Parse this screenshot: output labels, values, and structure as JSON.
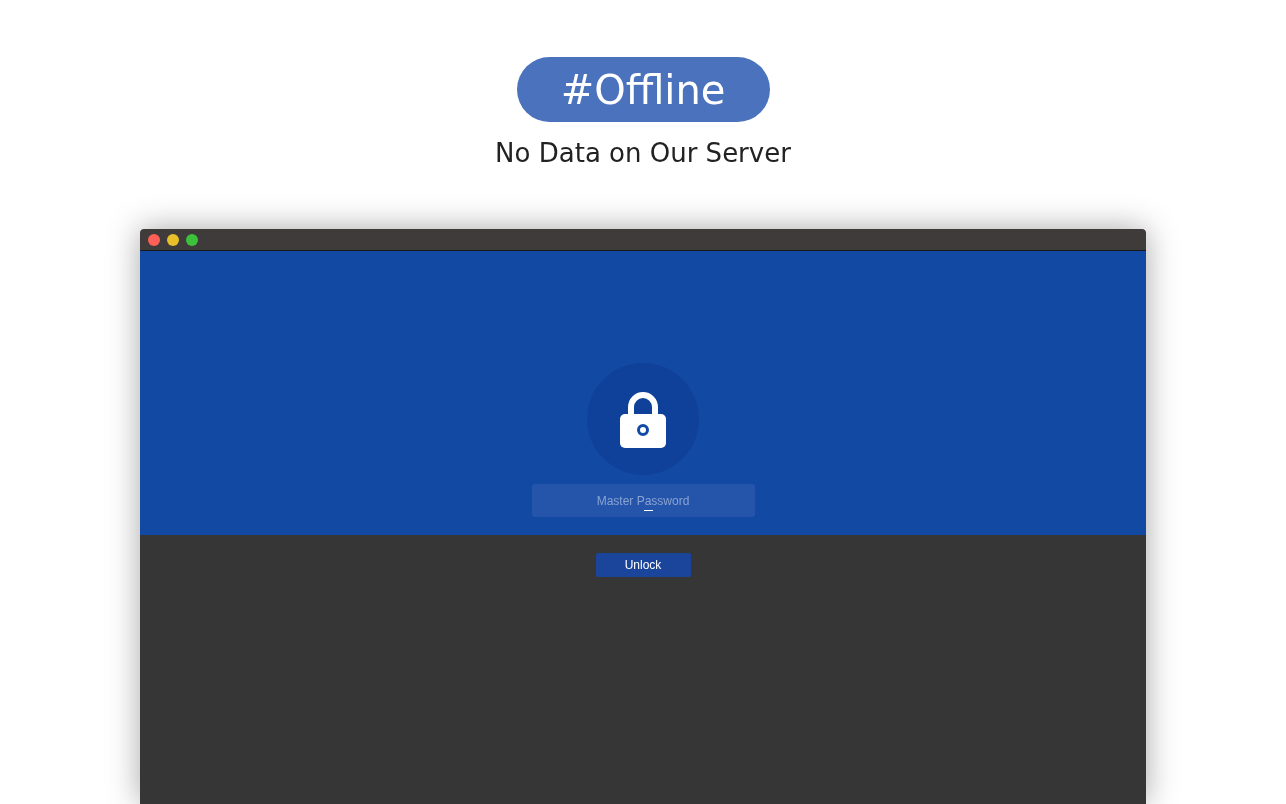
{
  "badge": "#Offline",
  "tagline": "No Data on Our Server",
  "app_window": {
    "password_field": {
      "placeholder": "Master Password"
    },
    "unlock_button": "Unlock"
  }
}
